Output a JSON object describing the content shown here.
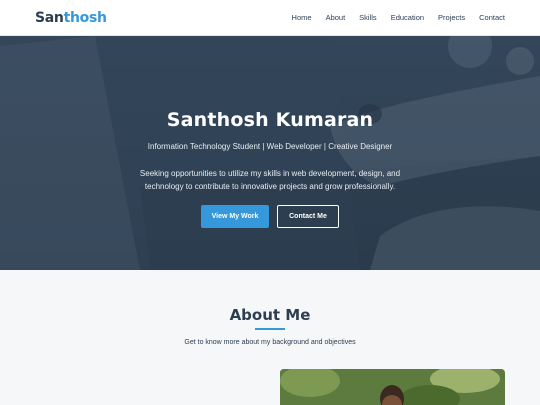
{
  "nav": {
    "logo_part1": "San",
    "logo_part2": "thosh",
    "items": [
      "Home",
      "About",
      "Skills",
      "Education",
      "Projects",
      "Contact"
    ]
  },
  "hero": {
    "title": "Santhosh Kumaran",
    "subtitle": "Information Technology Student | Web Developer | Creative Designer",
    "description": "Seeking opportunities to utilize my skills in web development, design, and technology to contribute to innovative projects and grow professionally.",
    "primary_button": "View My Work",
    "secondary_button": "Contact Me"
  },
  "about": {
    "title": "About Me",
    "subtitle": "Get to know more about my background and objectives"
  },
  "colors": {
    "brand_dark": "#2c3e50",
    "accent": "#3498db",
    "background": "#f6f7f8"
  }
}
